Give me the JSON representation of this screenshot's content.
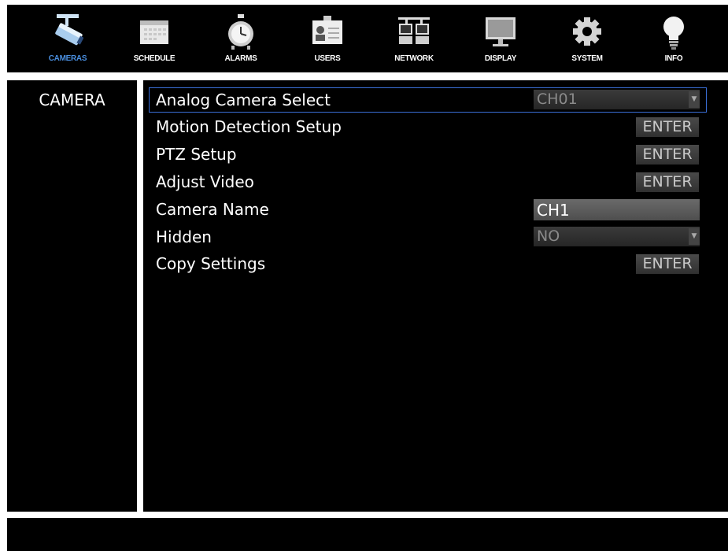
{
  "nav": {
    "items": [
      {
        "label": "CAMERAS",
        "icon": "camera-icon",
        "active": true
      },
      {
        "label": "SCHEDULE",
        "icon": "calendar-icon",
        "active": false
      },
      {
        "label": "ALARMS",
        "icon": "alarm-clock-icon",
        "active": false
      },
      {
        "label": "USERS",
        "icon": "id-card-icon",
        "active": false
      },
      {
        "label": "NETWORK",
        "icon": "network-icon",
        "active": false
      },
      {
        "label": "DISPLAY",
        "icon": "monitor-icon",
        "active": false
      },
      {
        "label": "SYSTEM",
        "icon": "gear-icon",
        "active": false
      },
      {
        "label": "INFO",
        "icon": "lightbulb-icon",
        "active": false
      }
    ],
    "active_color": "#4a8fe0"
  },
  "sidebar": {
    "title": "CAMERA"
  },
  "settings": {
    "rows": [
      {
        "label": "Analog Camera Select",
        "control": "dropdown",
        "value": "CH01"
      },
      {
        "label": "Motion Detection Setup",
        "control": "button",
        "button_label": "ENTER"
      },
      {
        "label": "PTZ Setup",
        "control": "button",
        "button_label": "ENTER"
      },
      {
        "label": "Adjust Video",
        "control": "button",
        "button_label": "ENTER"
      },
      {
        "label": "Camera Name",
        "control": "text",
        "value": "CH1"
      },
      {
        "label": "Hidden",
        "control": "dropdown",
        "value": "NO"
      },
      {
        "label": "Copy Settings",
        "control": "button",
        "button_label": "ENTER"
      }
    ],
    "selected_row_color": "#3a6fd8"
  }
}
